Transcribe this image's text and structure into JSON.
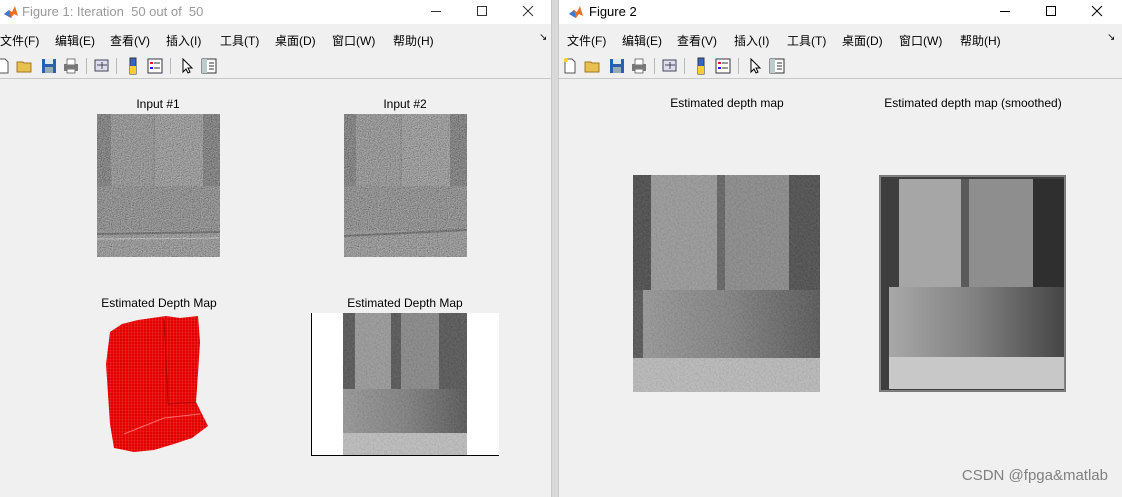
{
  "figure1": {
    "title": "Figure 1: Iteration  50 out of  50",
    "menu": [
      "文件(F)",
      "编辑(E)",
      "查看(V)",
      "插入(I)",
      "工具(T)",
      "桌面(D)",
      "窗口(W)",
      "帮助(H)"
    ],
    "axes": {
      "input1_title": "Input #1",
      "input2_title": "Input #2",
      "depth3d_title": "Estimated Depth Map",
      "depth2d_title": "Estimated Depth Map"
    }
  },
  "figure2": {
    "title": "Figure 2",
    "menu": [
      "文件(F)",
      "编辑(E)",
      "查看(V)",
      "插入(I)",
      "工具(T)",
      "桌面(D)",
      "窗口(W)",
      "帮助(H)"
    ],
    "axes": {
      "depth_title": "Estimated depth map",
      "smoothed_title": "Estimated depth map (smoothed)"
    }
  },
  "watermark": "CSDN @fpga&matlab",
  "colors": {
    "window_bg": "#f0f0f0",
    "mesh_red": "#e00000",
    "title_inactive": "#9a9a9a"
  },
  "icons": [
    "matlab-logo-icon",
    "minimize-icon",
    "maximize-icon",
    "close-icon",
    "new-file-icon",
    "open-folder-icon",
    "save-icon",
    "print-icon",
    "link-plot-icon",
    "colorbar-icon",
    "legend-icon",
    "pointer-icon",
    "property-editor-icon"
  ]
}
